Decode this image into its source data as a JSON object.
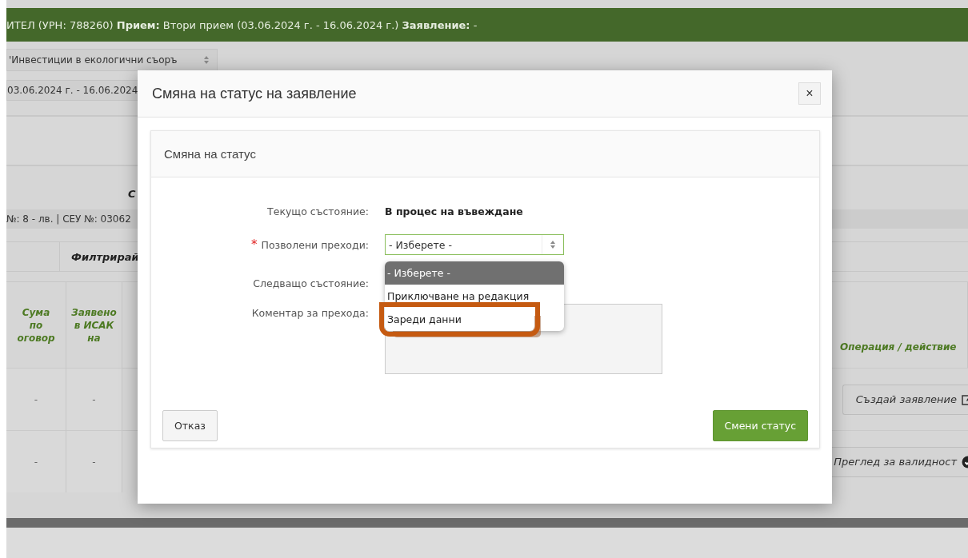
{
  "header_bar": {
    "text": "ИТЕЛ (УРН: 788260) **Прием:** Втори прием (03.06.2024 г. - 16.06.2024 г.) **Заявление:** -"
  },
  "measure_select": {
    "value": "'Инвестиции в екологични съоръ"
  },
  "period_field": {
    "value": "03.06.2024 г. - 16.06.2024"
  },
  "section_title": "С",
  "info_line": "№: 8 - лв. | СЕУ №: 03062",
  "filter_label": "Филтрирай",
  "table": {
    "columns": [
      {
        "lines": [
          "Сума",
          "по",
          "оговор"
        ]
      },
      {
        "lines": [
          "Заявено",
          "в ИСАК",
          "на"
        ]
      },
      {
        "lines": [
          "Операция / действие"
        ]
      }
    ],
    "rows": [
      {
        "cells": [
          "-",
          "-"
        ],
        "action": {
          "label": "Създай заявление",
          "kind": "edit"
        }
      },
      {
        "cells": [
          "-",
          "-"
        ],
        "action": {
          "label": "Преглед за валидност",
          "kind": "check"
        }
      }
    ]
  },
  "modal": {
    "title": "Смяна на статус на заявление",
    "close": "×",
    "required_mark": "*",
    "panel_title": "Смяна на статус",
    "fields": [
      {
        "kind": "text",
        "label": "Текущо състояние:",
        "value": "В процес на въвеждане",
        "required": false
      },
      {
        "kind": "select",
        "label": "Позволени преходи:",
        "value": "- Изберете -",
        "required": true,
        "focused": true
      },
      {
        "kind": "text",
        "label": "Следващо състояние:",
        "required": false
      },
      {
        "kind": "textarea",
        "label": "Коментар за прехода:",
        "required": false
      }
    ],
    "dropdown": {
      "options": [
        {
          "label": "- Изберете -",
          "selected": true,
          "highlighted": false
        },
        {
          "label": "Приключване на редакция",
          "selected": false,
          "highlighted": false
        },
        {
          "label": "Зареди данни",
          "selected": false,
          "highlighted": true
        }
      ]
    },
    "cancel_button": "Отказ",
    "submit_button": "Смени статус"
  }
}
